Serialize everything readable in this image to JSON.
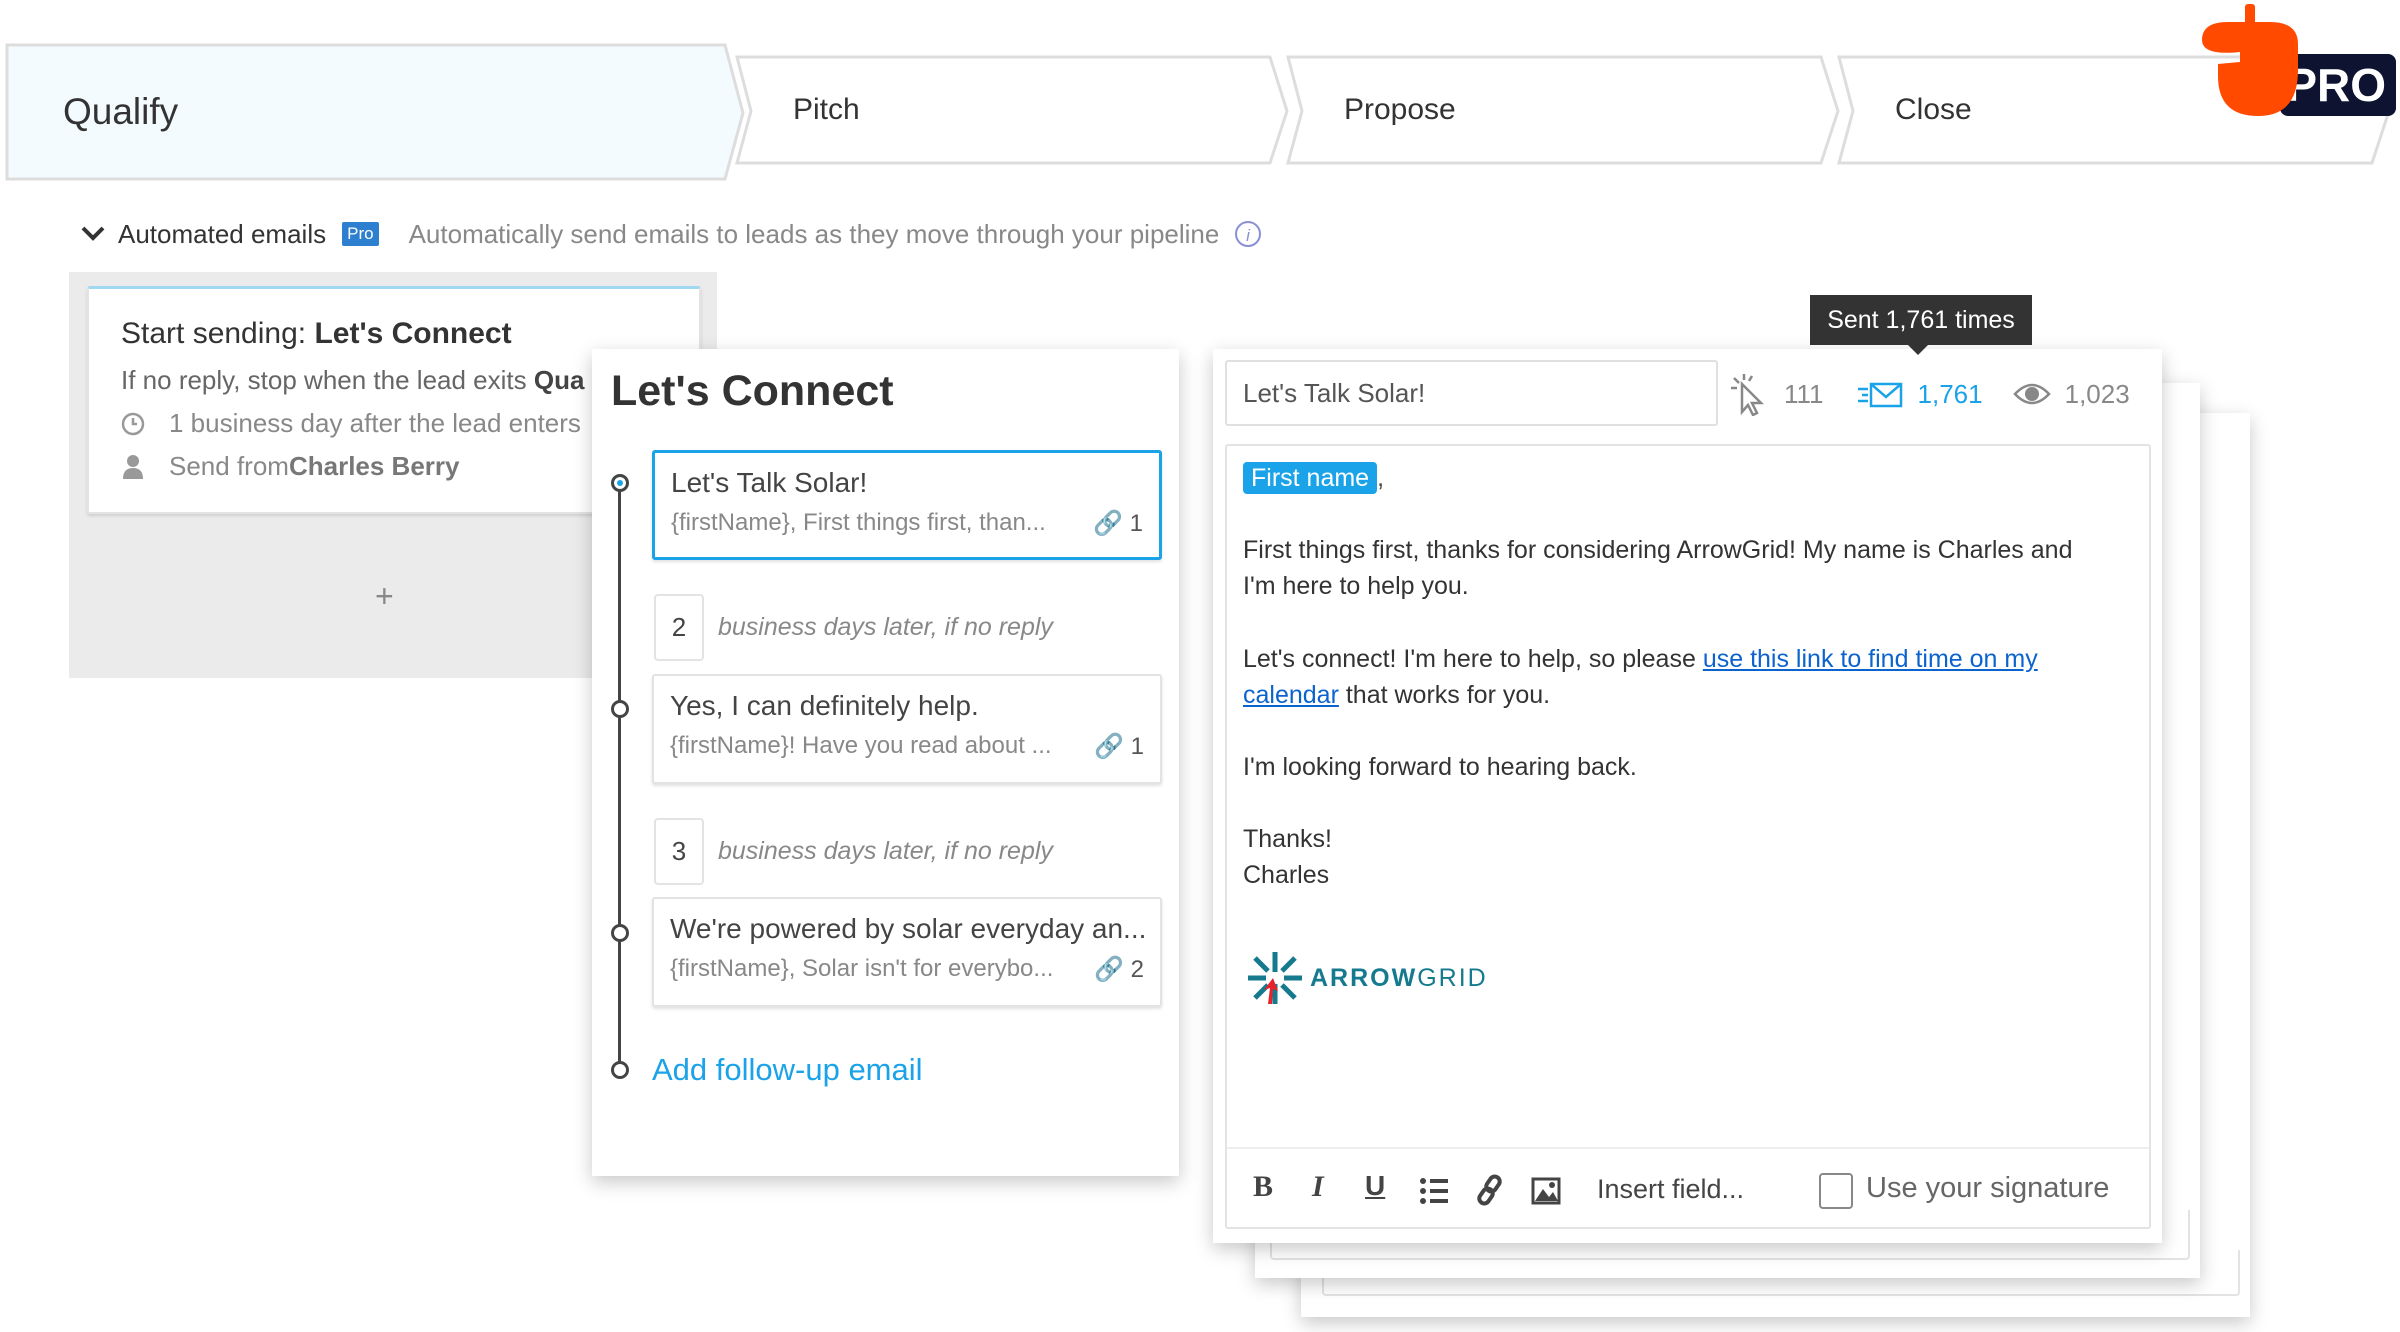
{
  "stages": [
    {
      "label": "Qualify",
      "active": true
    },
    {
      "label": "Pitch"
    },
    {
      "label": "Propose"
    },
    {
      "label": "Close"
    }
  ],
  "pro_badge": {
    "label": "PRO",
    "acorn_color": "#ff4a00",
    "box_color": "#0d1330"
  },
  "automated": {
    "title": "Automated emails",
    "badge": "Pro",
    "description": "Automatically send emails to leads as they move through your pipeline",
    "icons": [
      "chevron-down-icon",
      "info-icon"
    ]
  },
  "trigger_card": {
    "prefix": "Start sending: ",
    "sequence": "Let's Connect",
    "stop_prefix": "If no reply, stop when the lead exits ",
    "stop_stage": "Qua",
    "timing": "1 business day after the lead enters",
    "sender_prefix": "Send from ",
    "sender": "Charles Berry",
    "add": "+"
  },
  "sequence": {
    "title": "Let's Connect",
    "emails": [
      {
        "subject": "Let's Talk Solar!",
        "preview": "{firstName}, First things first, than...",
        "links": "1",
        "selected": true
      },
      {
        "subject": "Yes, I can definitely help.",
        "preview": "{firstName}! Have you read about ...",
        "links": "1"
      },
      {
        "subject": "We're powered by solar everyday an...",
        "preview": "{firstName}, Solar isn't for everybo...",
        "links": "2"
      }
    ],
    "delays": [
      {
        "days": "2",
        "label": "business days later, if no reply"
      },
      {
        "days": "3",
        "label": "business days later, if no reply"
      }
    ],
    "add_label": "Add follow-up email"
  },
  "editor": {
    "subject": "Let's Talk Solar!",
    "stats": {
      "clicks": "111",
      "sent": "1,761",
      "opens": "1,023"
    },
    "tooltip": "Sent 1,761 times",
    "merge_field": "First name",
    "comma": ",",
    "p1a": "First things first, thanks for considering ArrowGrid! My name is Charles and",
    "p1b": "I'm here to help you.",
    "p2a": "Let's connect! I'm here to help, so please ",
    "link_a": "use this link to find time on my ",
    "link_b": "calendar",
    "p2b": " that works for you.",
    "p3": "I'm looking forward to hearing back.",
    "p4": "Thanks!",
    "p5": "Charles",
    "logo_text_a": "ARROW",
    "logo_text_b": "GRID",
    "toolbar": {
      "insert_field": "Insert field...",
      "signature": "Use your signature",
      "signature_checked": false
    },
    "accent": "#00a3e0",
    "link_color": "#0b63ce"
  }
}
